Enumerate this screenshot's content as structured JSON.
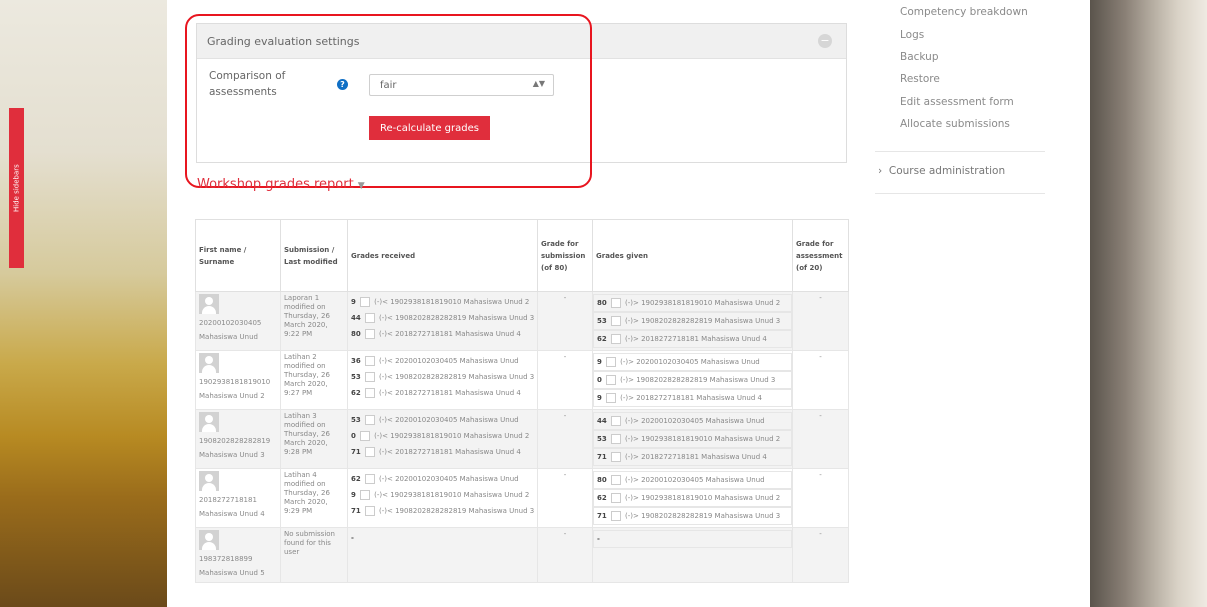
{
  "sidebar_toggle": "Hide sidebars",
  "settings": {
    "title": "Grading evaluation settings",
    "comparison_label": "Comparison of assessments",
    "comparison_value": "fair",
    "recalc_button": "Re-calculate grades"
  },
  "report_title": "Workshop grades report",
  "side_menu": {
    "items": [
      "Competency breakdown",
      "Logs",
      "Backup",
      "Restore",
      "Edit assessment form",
      "Allocate submissions"
    ],
    "course_admin": "Course administration"
  },
  "table": {
    "headers": {
      "name": "First name / Surname",
      "submission": "Submission / Last modified",
      "grades_received": "Grades received",
      "grade_submission": "Grade for submission (of 80)",
      "grades_given": "Grades given",
      "grade_assessment": "Grade for assessment (of 20)"
    },
    "rows": [
      {
        "user": "20200102030405 Mahasiswa Unud",
        "submission": "Laporan 1 modified on Thursday, 26 March 2020, 9:22 PM",
        "received": [
          {
            "grade": "9",
            "from": "(-)< 1902938181819010 Mahasiswa Unud 2"
          },
          {
            "grade": "44",
            "from": "(-)< 1908202828282819 Mahasiswa Unud 3"
          },
          {
            "grade": "80",
            "from": "(-)< 2018272718181 Mahasiswa Unud 4"
          }
        ],
        "grade_submission": "-",
        "given": [
          {
            "grade": "80",
            "to": "(-)> 1902938181819010 Mahasiswa Unud 2"
          },
          {
            "grade": "53",
            "to": "(-)> 1908202828282819 Mahasiswa Unud 3"
          },
          {
            "grade": "62",
            "to": "(-)> 2018272718181 Mahasiswa Unud 4"
          }
        ],
        "grade_assessment": "-"
      },
      {
        "user": "1902938181819010 Mahasiswa Unud 2",
        "submission": "Latihan 2 modified on Thursday, 26 March 2020, 9:27 PM",
        "received": [
          {
            "grade": "36",
            "from": "(-)< 20200102030405 Mahasiswa Unud"
          },
          {
            "grade": "53",
            "from": "(-)< 1908202828282819 Mahasiswa Unud 3"
          },
          {
            "grade": "62",
            "from": "(-)< 2018272718181 Mahasiswa Unud 4"
          }
        ],
        "grade_submission": "-",
        "given": [
          {
            "grade": "9",
            "to": "(-)> 20200102030405 Mahasiswa Unud"
          },
          {
            "grade": "0",
            "to": "(-)> 1908202828282819 Mahasiswa Unud 3"
          },
          {
            "grade": "9",
            "to": "(-)> 2018272718181 Mahasiswa Unud 4"
          }
        ],
        "grade_assessment": "-"
      },
      {
        "user": "1908202828282819 Mahasiswa Unud 3",
        "submission": "Latihan 3 modified on Thursday, 26 March 2020, 9:28 PM",
        "received": [
          {
            "grade": "53",
            "from": "(-)< 20200102030405 Mahasiswa Unud"
          },
          {
            "grade": "0",
            "from": "(-)< 1902938181819010 Mahasiswa Unud 2"
          },
          {
            "grade": "71",
            "from": "(-)< 2018272718181 Mahasiswa Unud 4"
          }
        ],
        "grade_submission": "-",
        "given": [
          {
            "grade": "44",
            "to": "(-)> 20200102030405 Mahasiswa Unud"
          },
          {
            "grade": "53",
            "to": "(-)> 1902938181819010 Mahasiswa Unud 2"
          },
          {
            "grade": "71",
            "to": "(-)> 2018272718181 Mahasiswa Unud 4"
          }
        ],
        "grade_assessment": "-"
      },
      {
        "user": "2018272718181 Mahasiswa Unud 4",
        "submission": "Latihan 4 modified on Thursday, 26 March 2020, 9:29 PM",
        "received": [
          {
            "grade": "62",
            "from": "(-)< 20200102030405 Mahasiswa Unud"
          },
          {
            "grade": "9",
            "from": "(-)< 1902938181819010 Mahasiswa Unud 2"
          },
          {
            "grade": "71",
            "from": "(-)< 1908202828282819 Mahasiswa Unud 3"
          }
        ],
        "grade_submission": "-",
        "given": [
          {
            "grade": "80",
            "to": "(-)> 20200102030405 Mahasiswa Unud"
          },
          {
            "grade": "62",
            "to": "(-)> 1902938181819010 Mahasiswa Unud 2"
          },
          {
            "grade": "71",
            "to": "(-)> 1908202828282819 Mahasiswa Unud 3"
          }
        ],
        "grade_assessment": "-"
      },
      {
        "user": "198372818899 Mahasiswa Unud 5",
        "submission": "No submission found for this user",
        "received": [
          {
            "grade": "-",
            "from": ""
          }
        ],
        "grade_submission": "-",
        "given": [
          {
            "grade": "-",
            "to": ""
          }
        ],
        "grade_assessment": "-"
      }
    ]
  }
}
